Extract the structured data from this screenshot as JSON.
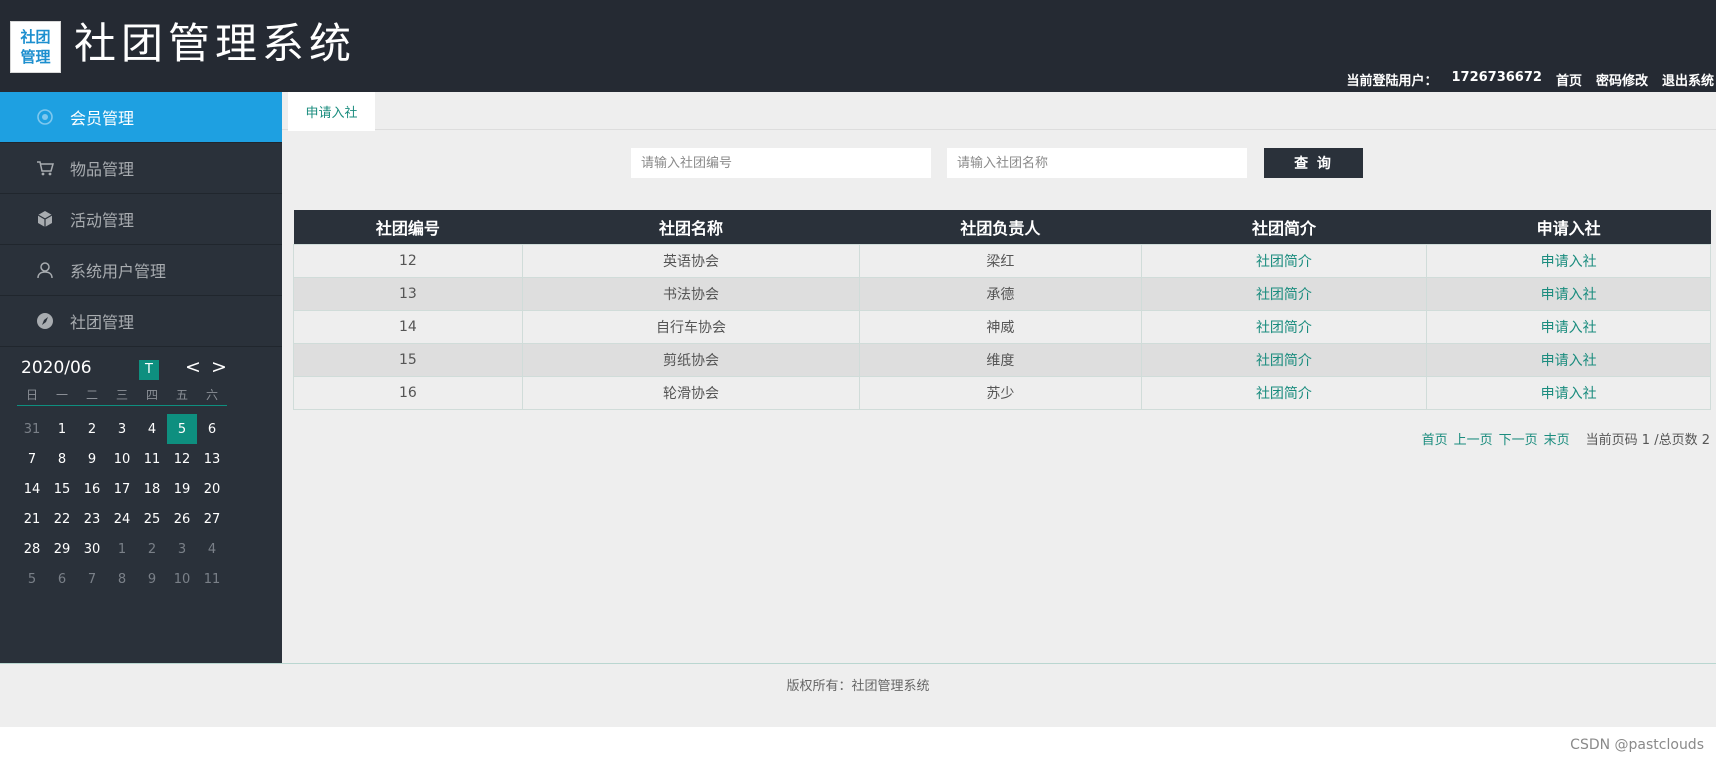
{
  "header": {
    "logo_line1": "社团",
    "logo_line2": "管理",
    "title": "社团管理系统",
    "user_label": "当前登陆用户：",
    "user_id": "1726736672",
    "link_home": "首页",
    "link_password": "密码修改",
    "link_logout": "退出系统"
  },
  "sidebar": {
    "items": [
      {
        "label": "会员管理",
        "icon": "member-icon",
        "active": true
      },
      {
        "label": "物品管理",
        "icon": "cart-icon"
      },
      {
        "label": "活动管理",
        "icon": "box-icon"
      },
      {
        "label": "系统用户管理",
        "icon": "user-icon"
      },
      {
        "label": "社团管理",
        "icon": "compass-icon"
      }
    ]
  },
  "calendar": {
    "year_month": "2020/06",
    "today_label": "T",
    "prev": "<",
    "next": ">",
    "weekdays": [
      "日",
      "一",
      "二",
      "三",
      "四",
      "五",
      "六"
    ],
    "days": [
      "31",
      "1",
      "2",
      "3",
      "4",
      "5",
      "6",
      "7",
      "8",
      "9",
      "10",
      "11",
      "12",
      "13",
      "14",
      "15",
      "16",
      "17",
      "18",
      "19",
      "20",
      "21",
      "22",
      "23",
      "24",
      "25",
      "26",
      "27",
      "28",
      "29",
      "30",
      "1",
      "2",
      "3",
      "4",
      "5",
      "6",
      "7",
      "8",
      "9",
      "10",
      "11"
    ],
    "selected_day": "5"
  },
  "tabs": [
    {
      "label": "申请入社"
    }
  ],
  "search": {
    "no_placeholder": "请输入社团编号",
    "name_placeholder": "请输入社团名称",
    "button_label": "查 询"
  },
  "table": {
    "headers": [
      "社团编号",
      "社团名称",
      "社团负责人",
      "社团简介",
      "申请入社"
    ],
    "rows": [
      [
        "12",
        "英语协会",
        "梁红",
        "社团简介",
        "申请入社"
      ],
      [
        "13",
        "书法协会",
        "承德",
        "社团简介",
        "申请入社"
      ],
      [
        "14",
        "自行车协会",
        "神威",
        "社团简介",
        "申请入社"
      ],
      [
        "15",
        "剪纸协会",
        "维度",
        "社团简介",
        "申请入社"
      ],
      [
        "16",
        "轮滑协会",
        "苏少",
        "社团简介",
        "申请入社"
      ]
    ]
  },
  "pager": {
    "first": "首页",
    "prev": "上一页",
    "next": "下一页",
    "last": "末页",
    "info": "当前页码 1 /总页数 2"
  },
  "footer": {
    "copyright": "版权所有：社团管理系统"
  },
  "watermark": "CSDN @pastclouds",
  "colors": {
    "header_bg": "#252a33",
    "sidebar_bg": "#2a313a",
    "active_menu": "#1ea0e1",
    "accent_teal": "#0e8f7f",
    "link": "#1a8c7e"
  }
}
